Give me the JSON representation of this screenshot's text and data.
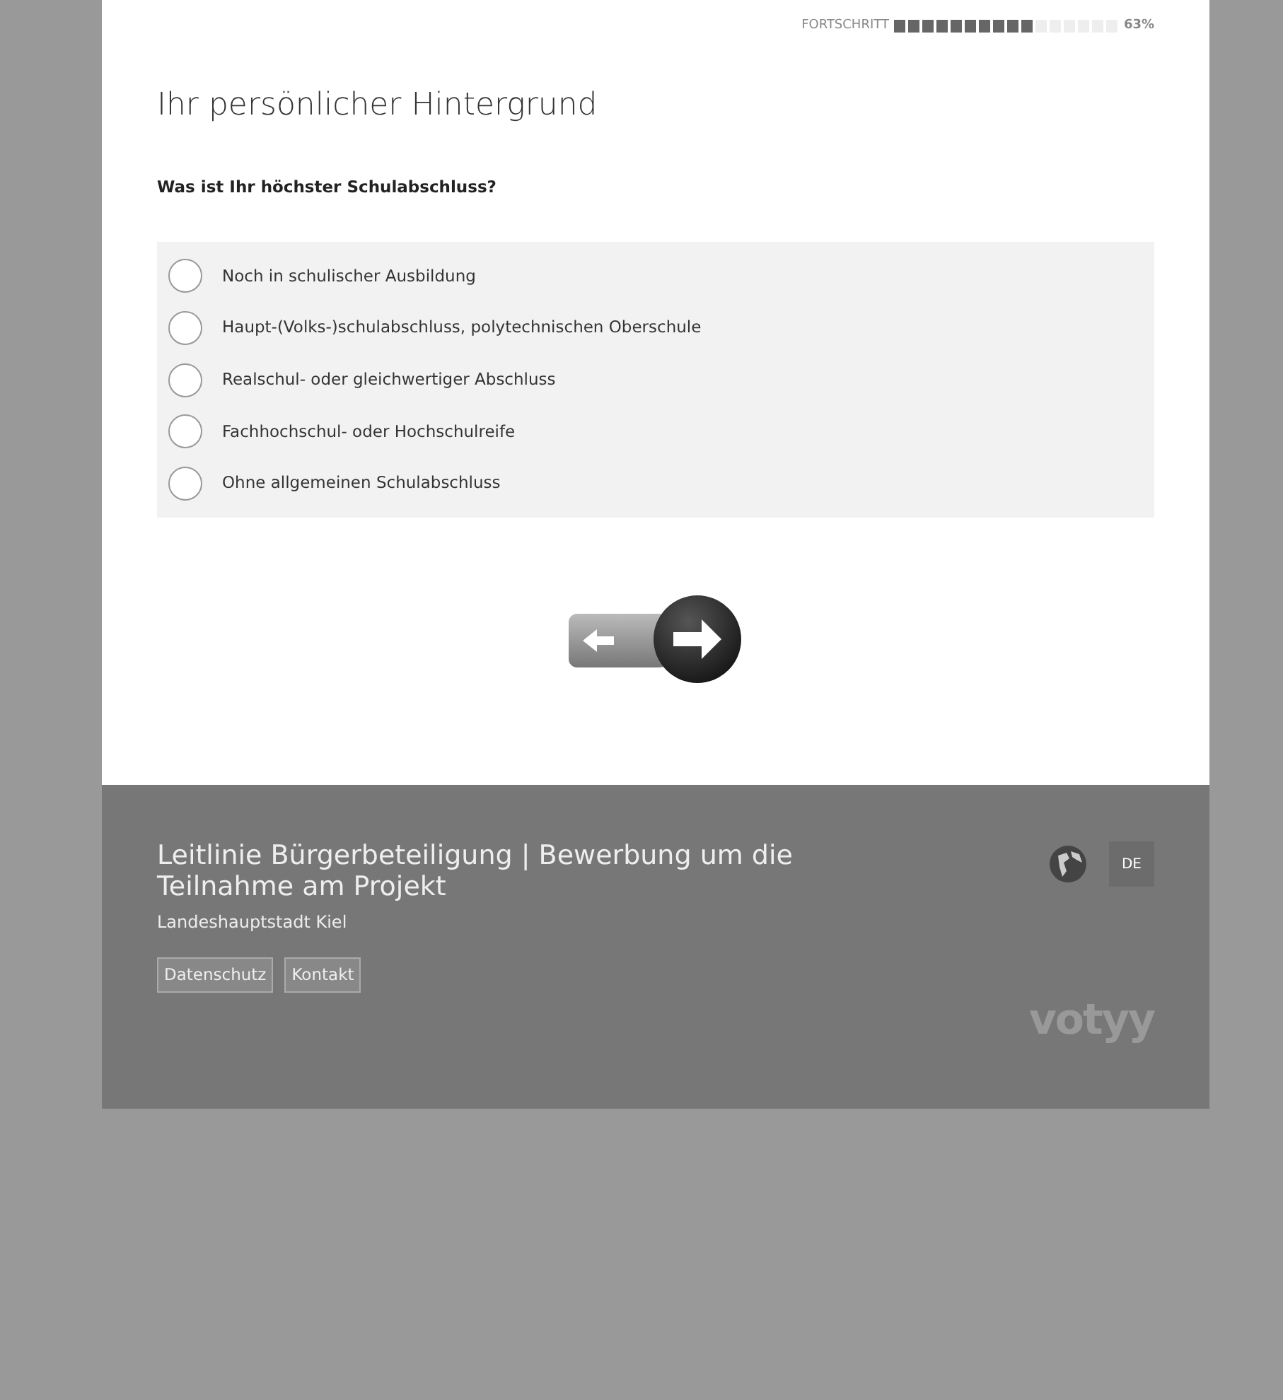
{
  "progress": {
    "label": "FORTSCHRITT",
    "level": 0.63,
    "reading": "63%"
  },
  "title": "Ihr persönlicher Hintergrund",
  "question": "Was ist Ihr höchster Schulabschluss?",
  "options": [
    {
      "label": "Noch in schulischer Ausbildung",
      "selected": false
    },
    {
      "label": "Haupt-(Volks-)schulabschluss, polytechnischen Oberschule",
      "selected": false
    },
    {
      "label": "Realschul- oder gleichwertiger Abschluss",
      "selected": false
    },
    {
      "label": "Fachhochschul- oder Hochschulreife",
      "selected": false
    },
    {
      "label": "Ohne allgemeinen Schulabschluss",
      "selected": false
    }
  ],
  "footer": {
    "title": "Leitlinie Bürgerbeteiligung | Bewerbung um die Teilnahme am Projekt",
    "subtitle": "Landeshauptstadt Kiel",
    "links": [
      "Datenschutz",
      "Kontakt"
    ],
    "language": "DE",
    "logo": "votyy"
  }
}
